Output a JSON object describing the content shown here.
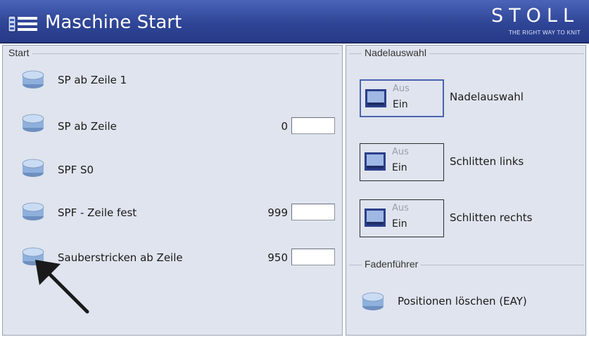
{
  "header": {
    "title": "Maschine Start",
    "brand": "STOLL",
    "tagline": "THE RIGHT WAY TO KNIT",
    "icon": "machine-list-icon"
  },
  "start_group": {
    "label": "Start",
    "rows": [
      {
        "label": "SP ab Zeile 1",
        "value": null
      },
      {
        "label": "SP ab Zeile",
        "value": "0"
      },
      {
        "label": "SPF S0",
        "value": null
      },
      {
        "label": "SPF - Zeile fest",
        "value": "999"
      },
      {
        "label": "Sauberstricken ab Zeile",
        "value": "950"
      }
    ]
  },
  "needle_group": {
    "label": "Nadelauswahl",
    "toggles": [
      {
        "off": "Aus",
        "on": "Ein",
        "label": "Nadelauswahl",
        "active": true
      },
      {
        "off": "Aus",
        "on": "Ein",
        "label": "Schlitten links",
        "active": false
      },
      {
        "off": "Aus",
        "on": "Ein",
        "label": "Schlitten rechts",
        "active": false
      }
    ]
  },
  "yarn_group": {
    "label": "Fadenführer",
    "button_label": "Positionen löschen (EAY)"
  },
  "colors": {
    "titlebar": "#2f4596",
    "panel": "#dfe4ee",
    "cylinder": "#9fc0e8",
    "toggle_border_active": "#4a63b0"
  }
}
